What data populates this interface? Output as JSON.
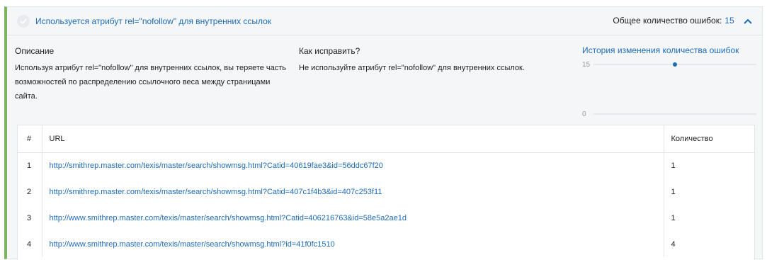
{
  "issue": {
    "title": "Используется атрибут rel=\"nofollow\" для внутренних ссылок",
    "total_label": "Общее количество ошибок:",
    "total_count": "15",
    "accent_color": "#7cb65c",
    "link_color": "#1e6bb8"
  },
  "description": {
    "heading": "Описание",
    "text": "Используя атрибут rel=\"nofollow\" для внутренних ссылок, вы теряете часть возможностей по распределению ссылочного веса между страницами сайта."
  },
  "fix": {
    "heading": "Как исправить?",
    "text": "Не используйте атрибут rel=\"nofollow\" для внутренних ссылок."
  },
  "history": {
    "title": "История изменения количества ошибок",
    "chart_data": {
      "type": "scatter",
      "y_ticks": [
        "15",
        "0"
      ],
      "ylim": [
        0,
        15
      ],
      "points": [
        {
          "y": 15
        }
      ]
    }
  },
  "table": {
    "headers": {
      "num": "#",
      "url": "URL",
      "count": "Количество"
    },
    "rows": [
      {
        "num": "1",
        "url": "http://smithrep.master.com/texis/master/search/showmsg.html?Catid=40619fae3&id=56ddc67f20",
        "count": "1"
      },
      {
        "num": "2",
        "url": "http://smithrep.master.com/texis/master/search/showmsg.html?Catid=407c1f4b3&id=407c253f11",
        "count": "1"
      },
      {
        "num": "3",
        "url": "http://www.smithrep.master.com/texis/master/search/showmsg.html?Catid=406216763&id=58e5a2ae1d",
        "count": "1"
      },
      {
        "num": "4",
        "url": "http://www.smithrep.master.com/texis/master/search/showmsg.html?id=41f0fc1510",
        "count": "4"
      }
    ]
  }
}
